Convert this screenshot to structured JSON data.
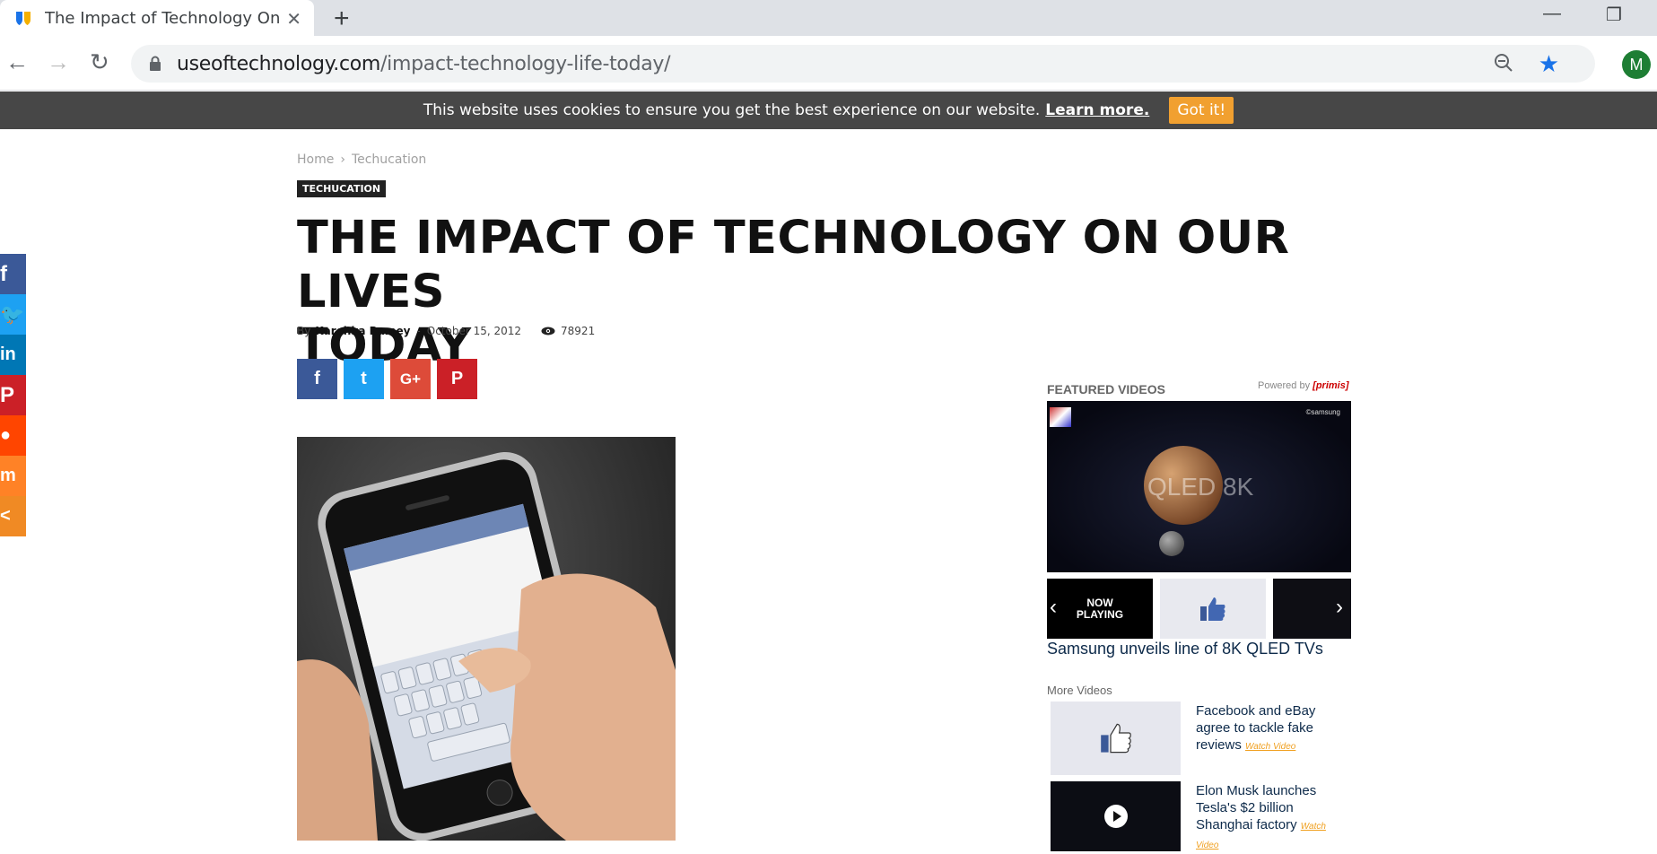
{
  "browser": {
    "tab_title": "The Impact of Technology On Our Lives Today",
    "url_domain": "useoftechnology.com",
    "url_path": "/impact-technology-life-today/",
    "profile_initial": "M"
  },
  "cookie_bar": {
    "message": "This website uses cookies to ensure you get the best experience on our website.",
    "link_label": "Learn more.",
    "button_label": "Got it!"
  },
  "breadcrumb": {
    "home": "Home",
    "separator": "›",
    "category": "Techucation"
  },
  "article": {
    "category_badge": "TECHUCATION",
    "title_line1": "THE IMPACT OF TECHNOLOGY ON OUR LIVES",
    "title_line2": "TODAY",
    "by_label": "By",
    "author": "Karehka Ramey",
    "dash": "-",
    "date": "October 15, 2012",
    "views": "78921"
  },
  "share_buttons": [
    "facebook",
    "twitter",
    "google-plus",
    "pinterest"
  ],
  "side_share": [
    "facebook",
    "twitter",
    "linkedin",
    "pinterest",
    "reddit",
    "mix",
    "share"
  ],
  "video_widget": {
    "label": "FEATURED VIDEOS",
    "powered_by": "Powered by",
    "brand": "[primis]",
    "main_overlay": "QLED 8K",
    "main_logo": "©samsung",
    "now_playing": "NOW PLAYING",
    "current_title": "Samsung unveils line of 8K QLED TVs",
    "more_label": "More Videos",
    "more": [
      {
        "title": "Facebook and eBay agree to tackle fake reviews",
        "watch": "Watch Video"
      },
      {
        "title": "Elon Musk launches Tesla's $2 billion Shanghai factory",
        "watch": "Watch Video"
      }
    ]
  },
  "colors": {
    "facebook": "#3b5998",
    "twitter": "#1da1f2",
    "google": "#dd4b39",
    "pinterest": "#cb2027",
    "linkedin": "#0077b5",
    "reddit": "#ff4500",
    "mix": "#ff8226",
    "share": "#f08a24",
    "cookie_button": "#f1a030"
  }
}
